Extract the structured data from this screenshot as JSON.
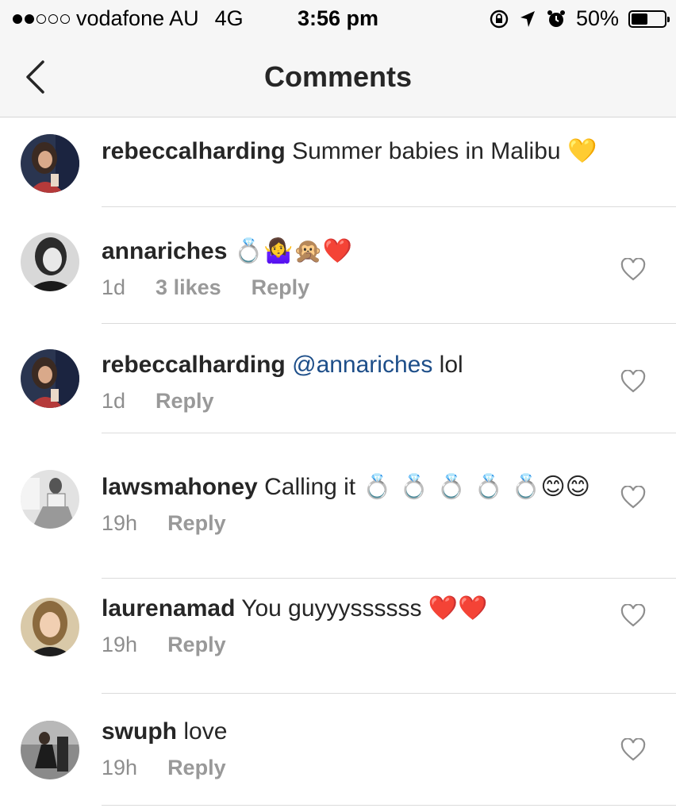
{
  "status_bar": {
    "carrier": "vodafone AU",
    "network": "4G",
    "time": "3:56 pm",
    "battery": "50%",
    "battery_level": 0.5
  },
  "nav": {
    "title": "Comments"
  },
  "comments": [
    {
      "username": "rebeccalharding",
      "text": "Summer babies in Malibu",
      "emoji": "💛"
    },
    {
      "username": "annariches",
      "text": "",
      "emoji": "💍🤷‍♀️🙊❤️",
      "time": "1d",
      "likes": "3 likes",
      "reply": "Reply"
    },
    {
      "username": "rebeccalharding",
      "mention": "@annariches",
      "text": "lol",
      "time": "1d",
      "reply": "Reply"
    },
    {
      "username": "lawsmahoney",
      "text": "Calling it",
      "emoji": "💍 💍 💍 💍 💍😊😊",
      "time": "19h",
      "reply": "Reply"
    },
    {
      "username": "laurenamad",
      "text": "You guyyyssssss",
      "emoji": "❤️❤️",
      "time": "19h",
      "reply": "Reply"
    },
    {
      "username": "swuph",
      "text": "love",
      "time": "19h",
      "reply": "Reply"
    }
  ],
  "colors": {
    "mention": "#1d4e89",
    "meta": "#8e8e8e",
    "divider": "#dbdbdb",
    "bar_bg": "#f6f6f6"
  }
}
